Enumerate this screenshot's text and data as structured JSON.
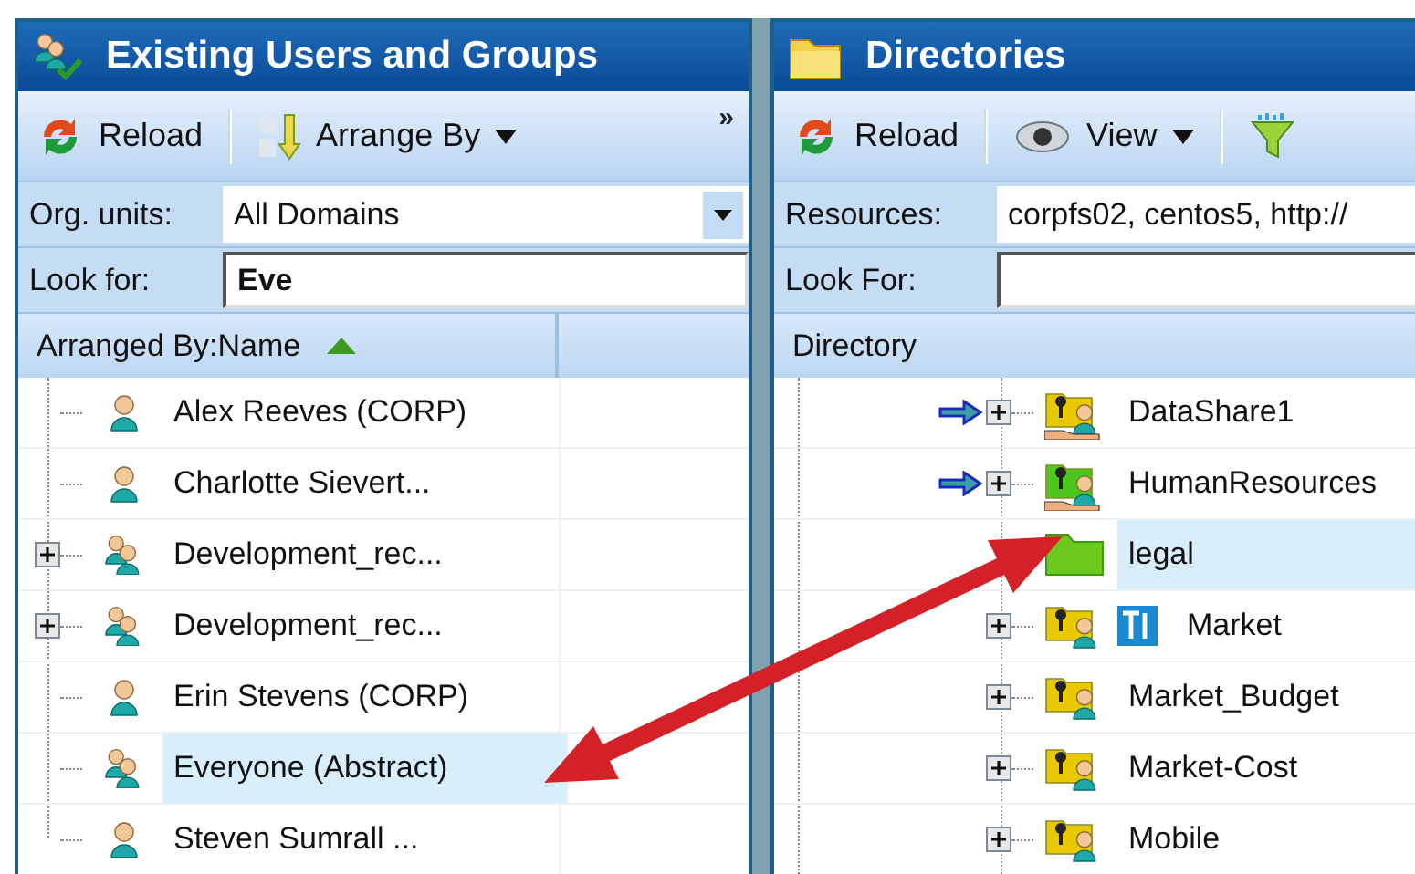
{
  "left_panel": {
    "title": "Existing Users and Groups",
    "toolbar": [
      {
        "kind": "reload",
        "label": "Reload",
        "dropdown": false
      },
      {
        "kind": "sort",
        "label": "Arrange By",
        "dropdown": true
      }
    ],
    "overflow": "»",
    "filters": [
      {
        "kind": "select",
        "label": "Org. units:",
        "value": "All Domains"
      },
      {
        "kind": "text",
        "label": "Look for:",
        "value": "Eve"
      }
    ],
    "column_header": "Arranged By:Name",
    "sort_ascending": true,
    "items": [
      {
        "name": "Alex Reeves (CORP)",
        "kind": "user",
        "expandable": false,
        "selected": false
      },
      {
        "name": "Charlotte Sievert...",
        "kind": "user",
        "expandable": false,
        "selected": false
      },
      {
        "name": "Development_rec...",
        "kind": "group",
        "expandable": true,
        "selected": false
      },
      {
        "name": "Development_rec...",
        "kind": "group",
        "expandable": true,
        "selected": false
      },
      {
        "name": "Erin Stevens (CORP)",
        "kind": "user",
        "expandable": false,
        "selected": false
      },
      {
        "name": "Everyone (Abstract)",
        "kind": "group",
        "expandable": false,
        "selected": true
      },
      {
        "name": "Steven Sumrall ...",
        "kind": "user",
        "expandable": false,
        "selected": false
      }
    ]
  },
  "right_panel": {
    "title": "Directories",
    "toolbar": [
      {
        "kind": "reload",
        "label": "Reload",
        "dropdown": false
      },
      {
        "kind": "view",
        "label": "View",
        "dropdown": true
      },
      {
        "kind": "filter",
        "dropdown": false
      }
    ],
    "filters": [
      {
        "kind": "text-plain",
        "label": "Resources:",
        "value": "corpfs02, centos5, http://"
      },
      {
        "kind": "text",
        "label": "Look For:"
      }
    ],
    "column_header": "Directory",
    "items": [
      {
        "name": "DataShare1",
        "kind": "shared",
        "color": "#e8c800",
        "mapped": true,
        "expandable": true,
        "tagged": false,
        "selected": false
      },
      {
        "name": "HumanResources",
        "kind": "shared",
        "color": "#4cc81c",
        "mapped": true,
        "expandable": true,
        "tagged": false,
        "selected": false
      },
      {
        "name": "legal",
        "kind": "folder",
        "color": "#6cc81c",
        "mapped": false,
        "expandable": false,
        "tagged": false,
        "selected": true
      },
      {
        "name": "Market",
        "kind": "user-folder",
        "color": "#e8c800",
        "mapped": false,
        "expandable": true,
        "tagged": true,
        "selected": false
      },
      {
        "name": "Market_Budget",
        "kind": "user-folder",
        "color": "#e8c800",
        "mapped": false,
        "expandable": true,
        "tagged": false,
        "selected": false
      },
      {
        "name": "Market-Cost",
        "kind": "user-folder",
        "color": "#e8c800",
        "mapped": false,
        "expandable": true,
        "tagged": false,
        "selected": false
      },
      {
        "name": "Mobile",
        "kind": "user-folder",
        "color": "#e8c800",
        "mapped": false,
        "expandable": true,
        "tagged": false,
        "selected": false
      }
    ]
  }
}
